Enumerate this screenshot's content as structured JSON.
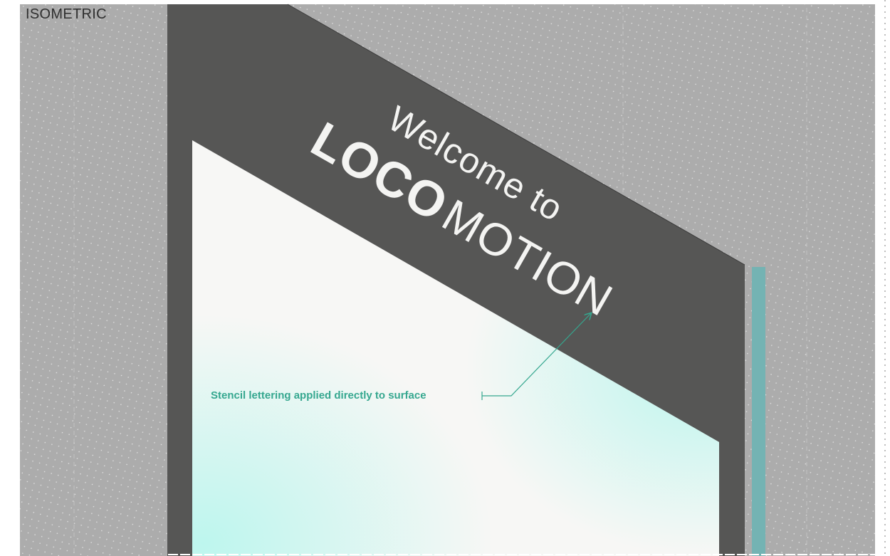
{
  "view": {
    "title": "ISOMETRIC"
  },
  "sign": {
    "line1": "Welcome to",
    "line2_big": "LOCO",
    "line2_rest": "MOTION"
  },
  "annotation": {
    "text": "Stencil lettering applied directly to surface"
  },
  "colors": {
    "background": "#acacac",
    "dot_pattern": "#e4e4e4",
    "wall": "#565655",
    "panel": "#f7f7f5",
    "panel_glow": "#bdf6ee",
    "lettering": "#f4f4f2",
    "accent": "#35a78f",
    "edge_strip": "#74b3b3"
  }
}
